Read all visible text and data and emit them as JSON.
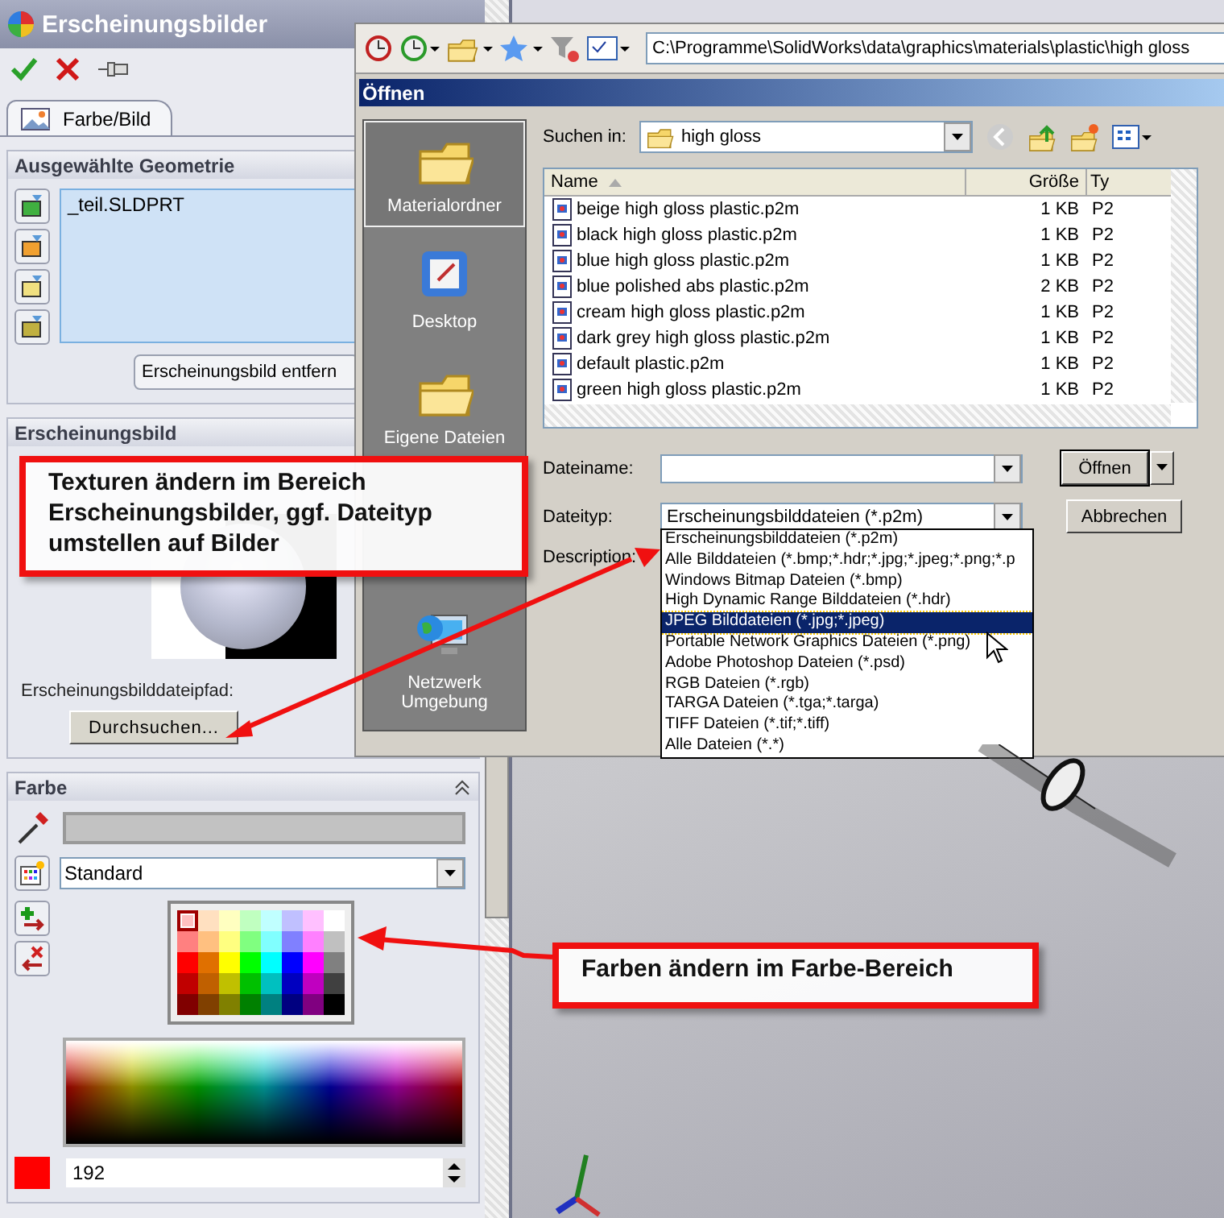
{
  "property_manager": {
    "title": "Erscheinungsbilder",
    "tab": {
      "label": "Farbe/Bild",
      "selected": true
    }
  },
  "selected_geometry": {
    "title": "Ausgewählte Geometrie",
    "items": [
      "_teil.SLDPRT"
    ],
    "remove_button": "Erscheinungsbild entfern"
  },
  "appearance": {
    "title": "Erscheinungsbild",
    "path_label": "Erscheinungsbilddateipfad:",
    "browse_button": "Durchsuchen..."
  },
  "color": {
    "title": "Farbe",
    "expanded": true,
    "palette_name": "Standard",
    "value": "192",
    "swatches": [
      {
        "color": "#ffc0c0",
        "selected": true
      },
      {
        "color": "#ffe0c0",
        "selected": false
      },
      {
        "color": "#ffffc0",
        "selected": false
      },
      {
        "color": "#c0ffc0",
        "selected": false
      },
      {
        "color": "#c0ffff",
        "selected": false
      },
      {
        "color": "#c0c0ff",
        "selected": false
      },
      {
        "color": "#ffc0ff",
        "selected": false
      },
      {
        "color": "#ffffff",
        "selected": false
      },
      {
        "color": "#ff8080",
        "selected": false
      },
      {
        "color": "#ffc080",
        "selected": false
      },
      {
        "color": "#ffff80",
        "selected": false
      },
      {
        "color": "#80ff80",
        "selected": false
      },
      {
        "color": "#80ffff",
        "selected": false
      },
      {
        "color": "#8080ff",
        "selected": false
      },
      {
        "color": "#ff80ff",
        "selected": false
      },
      {
        "color": "#c0c0c0",
        "selected": false
      },
      {
        "color": "#ff0000",
        "selected": false
      },
      {
        "color": "#e07000",
        "selected": false
      },
      {
        "color": "#ffff00",
        "selected": false
      },
      {
        "color": "#00ff00",
        "selected": false
      },
      {
        "color": "#00ffff",
        "selected": false
      },
      {
        "color": "#0000ff",
        "selected": false
      },
      {
        "color": "#ff00ff",
        "selected": false
      },
      {
        "color": "#808080",
        "selected": false
      },
      {
        "color": "#c00000",
        "selected": false
      },
      {
        "color": "#c06000",
        "selected": false
      },
      {
        "color": "#c0c000",
        "selected": false
      },
      {
        "color": "#00c000",
        "selected": false
      },
      {
        "color": "#00c0c0",
        "selected": false
      },
      {
        "color": "#0000c0",
        "selected": false
      },
      {
        "color": "#c000c0",
        "selected": false
      },
      {
        "color": "#404040",
        "selected": false
      },
      {
        "color": "#800000",
        "selected": false
      },
      {
        "color": "#804000",
        "selected": false
      },
      {
        "color": "#808000",
        "selected": false
      },
      {
        "color": "#008000",
        "selected": false
      },
      {
        "color": "#008080",
        "selected": false
      },
      {
        "color": "#000080",
        "selected": false
      },
      {
        "color": "#800080",
        "selected": false
      },
      {
        "color": "#000000",
        "selected": false
      }
    ]
  },
  "dialog": {
    "address": "C:\\Programme\\SolidWorks\\data\\graphics\\materials\\plastic\\high gloss",
    "title": "Öffnen",
    "places": [
      {
        "label": "Materialordner",
        "selected": true
      },
      {
        "label": "Desktop",
        "selected": false
      },
      {
        "label": "Eigene Dateien",
        "selected": false
      },
      {
        "label": "Netzwerk Umgebung",
        "selected": false
      }
    ],
    "look_in_label": "Suchen in:",
    "look_in": "high gloss",
    "columns": [
      "Name",
      "Größe",
      "Ty"
    ],
    "files": [
      {
        "name": "beige high gloss plastic.p2m",
        "size": "1 KB",
        "type": "P2"
      },
      {
        "name": "black high gloss plastic.p2m",
        "size": "1 KB",
        "type": "P2"
      },
      {
        "name": "blue high gloss plastic.p2m",
        "size": "1 KB",
        "type": "P2"
      },
      {
        "name": "blue polished abs plastic.p2m",
        "size": "2 KB",
        "type": "P2"
      },
      {
        "name": "cream high gloss plastic.p2m",
        "size": "1 KB",
        "type": "P2"
      },
      {
        "name": "dark grey high gloss plastic.p2m",
        "size": "1 KB",
        "type": "P2"
      },
      {
        "name": "default plastic.p2m",
        "size": "1 KB",
        "type": "P2"
      },
      {
        "name": "green high gloss plastic.p2m",
        "size": "1 KB",
        "type": "P2"
      }
    ],
    "file_name_label": "Dateiname:",
    "file_type_label": "Dateityp:",
    "file_type": "Erscheinungsbilddateien (*.p2m)",
    "description_label": "Description:",
    "open_button": "Öffnen",
    "cancel_button": "Abbrechen",
    "file_type_options": [
      {
        "label": "Erscheinungsbilddateien (*.p2m)",
        "selected": false
      },
      {
        "label": "Alle Bilddateien (*.bmp;*.hdr;*.jpg;*.jpeg;*.png;*.p",
        "selected": false
      },
      {
        "label": "Windows Bitmap Dateien (*.bmp)",
        "selected": false
      },
      {
        "label": "High Dynamic Range Bilddateien (*.hdr)",
        "selected": false
      },
      {
        "label": "JPEG Bilddateien (*.jpg;*.jpeg)",
        "selected": true
      },
      {
        "label": "Portable Network Graphics Dateien (*.png)",
        "selected": false
      },
      {
        "label": "Adobe Photoshop Dateien (*.psd)",
        "selected": false
      },
      {
        "label": "RGB Dateien (*.rgb)",
        "selected": false
      },
      {
        "label": "TARGA Dateien (*.tga;*.targa)",
        "selected": false
      },
      {
        "label": "TIFF Dateien (*.tif;*.tiff)",
        "selected": false
      },
      {
        "label": "Alle Dateien (*.*)",
        "selected": false
      }
    ]
  },
  "callouts": [
    {
      "text": "Texturen ändern im Bereich Erscheinungsbilder, ggf. Dateityp umstellen auf Bilder"
    },
    {
      "text": "Farben ändern im Farbe-Bereich"
    }
  ]
}
